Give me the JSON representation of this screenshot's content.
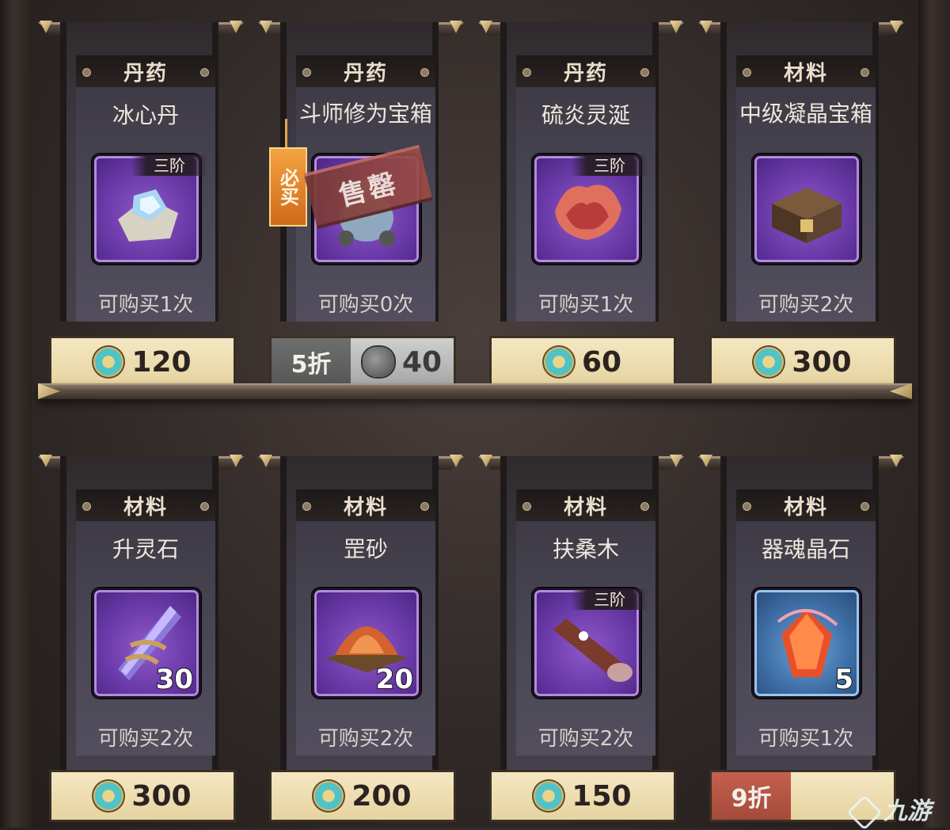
{
  "shelves": [
    {
      "items": [
        {
          "category": "丹药",
          "name": "冰心丹",
          "tier": "三阶",
          "quantity": "",
          "limit": "可购买1次",
          "discount": "",
          "price": "120",
          "currency": "coin-icon",
          "icon": "ice-heart-pill-icon",
          "frame": "purple"
        },
        {
          "category": "丹药",
          "name": "斗师修为宝箱",
          "tier": "",
          "quantity": "",
          "limit": "可购买0次",
          "discount": "5折",
          "price": "40",
          "currency": "stone-icon",
          "icon": "treasure-chest-icon",
          "frame": "purple",
          "sold_out": "售罄",
          "must_buy": "必买"
        },
        {
          "category": "丹药",
          "name": "硫炎灵涎",
          "tier": "三阶",
          "quantity": "",
          "limit": "可购买1次",
          "discount": "",
          "price": "60",
          "currency": "coin-icon",
          "icon": "flame-shell-icon",
          "frame": "purple"
        },
        {
          "category": "材料",
          "name": "中级凝晶宝箱",
          "tier": "",
          "quantity": "",
          "limit": "可购买2次",
          "discount": "",
          "price": "300",
          "currency": "coin-icon",
          "icon": "crystal-chest-icon",
          "frame": "purple"
        }
      ]
    },
    {
      "items": [
        {
          "category": "材料",
          "name": "升灵石",
          "tier": "",
          "quantity": "30",
          "limit": "可购买2次",
          "discount": "",
          "price": "300",
          "currency": "coin-icon",
          "icon": "spirit-stone-icon",
          "frame": "purple"
        },
        {
          "category": "材料",
          "name": "罡砂",
          "tier": "",
          "quantity": "20",
          "limit": "可购买2次",
          "discount": "",
          "price": "200",
          "currency": "coin-icon",
          "icon": "sand-tray-icon",
          "frame": "purple"
        },
        {
          "category": "材料",
          "name": "扶桑木",
          "tier": "三阶",
          "quantity": "",
          "limit": "可购买2次",
          "discount": "",
          "price": "150",
          "currency": "coin-icon",
          "icon": "wood-log-icon",
          "frame": "purple"
        },
        {
          "category": "材料",
          "name": "器魂晶石",
          "tier": "",
          "quantity": "5",
          "limit": "可购买1次",
          "discount": "9折",
          "price": "",
          "currency": "",
          "icon": "soul-crystal-icon",
          "frame": "blue"
        }
      ]
    }
  ],
  "watermark": "九游"
}
